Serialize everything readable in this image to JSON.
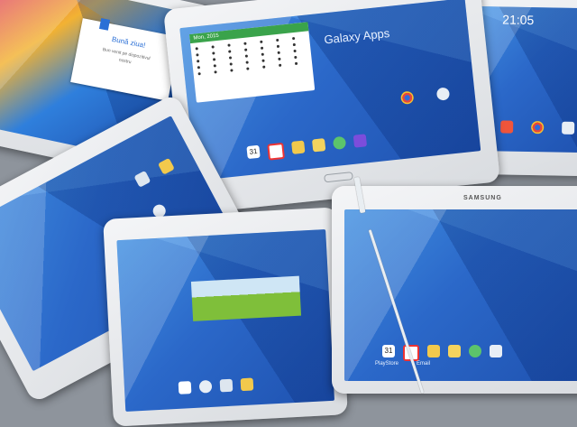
{
  "greeting_card": {
    "title": "Bună ziua!",
    "body_line1": "Bun venit pe dispozitivul",
    "body_line2": "nostru"
  },
  "top_tablet": {
    "calendar_header": "Mon, 2015",
    "widget_title": "Galaxy Apps"
  },
  "right_top_tablet": {
    "clock": "21:05"
  },
  "brand": "SAMSUNG",
  "dock_labels": {
    "calendar_day": "31",
    "playstore": "PlayStore",
    "email": "Email"
  },
  "colors": {
    "screen_blue": "#2b68c9",
    "bezel": "#f4f5f7",
    "green_header": "#3aa34b"
  },
  "icons": [
    "chrome-icon",
    "gallery-icon",
    "calendar-icon",
    "email-icon",
    "settings-icon",
    "camera-icon",
    "music-icon",
    "store-icon"
  ]
}
